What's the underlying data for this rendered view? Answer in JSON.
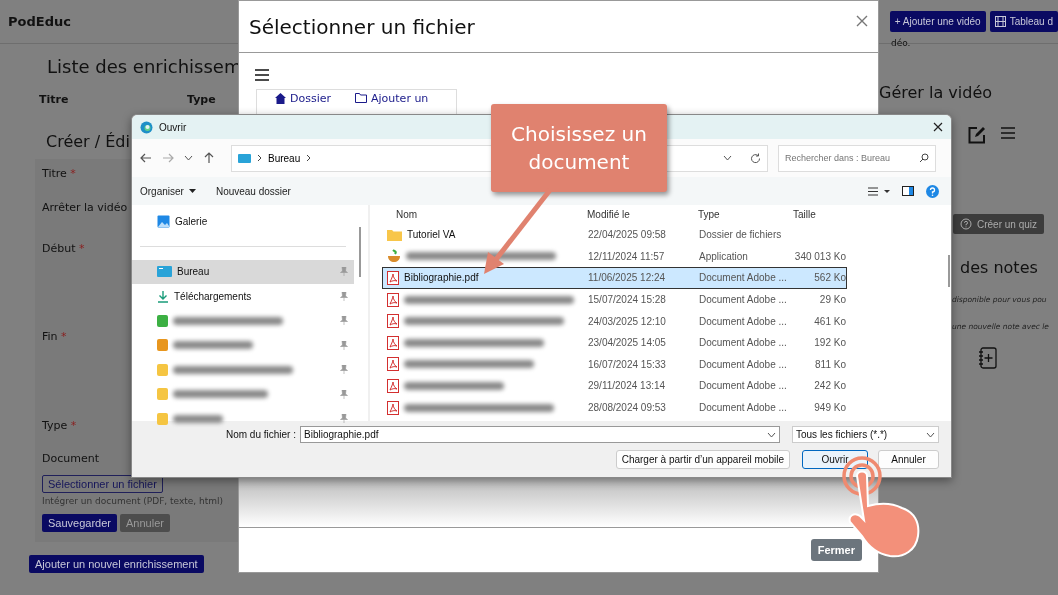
{
  "page": {
    "brand": "PodEduc",
    "header_buttons": [
      {
        "kind": "add",
        "label": "+ Ajouter une vidéo"
      },
      {
        "kind": "dashboard",
        "label": "Tableau d"
      }
    ],
    "left": {
      "title": "Liste des enrichissem",
      "columns": [
        "Titre",
        "Type"
      ],
      "form_title": "Créer / Édi",
      "fields": [
        {
          "label": "Titre",
          "mark": "*"
        },
        {
          "label": "Arrêter la vidéo"
        },
        {
          "label": "Début",
          "mark": "*"
        },
        {
          "label": "Fin",
          "mark": "*"
        },
        {
          "label": "Type",
          "mark": "*"
        },
        {
          "label": "Document"
        }
      ],
      "file_button": "Sélectionner un fichier",
      "hint": "Intégrer un document (PDF, texte, html)",
      "save": "Sauvegarder",
      "cancel": "Annuler",
      "add_button": "Ajouter un nouvel enrichissement"
    },
    "right": {
      "fragment": "déo.",
      "manage_title": "Gérer la vidéo",
      "quiz_button": "Créer un quiz",
      "notes_title": "des notes",
      "notes_lines": [
        "disponible pour vous pou",
        "une nouvelle note avec le"
      ]
    }
  },
  "modal": {
    "title": "Sélectionner un fichier",
    "tabs": [
      {
        "kind": "home",
        "label": "Dossier"
      },
      {
        "kind": "folder",
        "label": "Ajouter un"
      }
    ],
    "close_button": "Fermer"
  },
  "dialog": {
    "title": "Ouvrir",
    "path": [
      "Bureau"
    ],
    "search_placeholder": "Rechercher dans : Bureau",
    "toolbar": [
      "Organiser",
      "Nouveau dossier"
    ],
    "sidebar": [
      {
        "kind": "gallery",
        "label": "Galerie",
        "selected": false
      },
      {
        "kind": "desktop",
        "label": "Bureau",
        "selected": true
      },
      {
        "kind": "download",
        "label": "Téléchargements",
        "selected": false
      },
      {
        "kind": "blurred",
        "color": "#3cb043",
        "selected": false
      },
      {
        "kind": "blurred",
        "color": "#e8961e",
        "selected": false
      },
      {
        "kind": "blurred",
        "color": "#f5c542",
        "selected": false
      },
      {
        "kind": "blurred",
        "color": "#f5c542",
        "selected": false
      },
      {
        "kind": "blurred",
        "color": "#f5c542",
        "selected": false
      }
    ],
    "columns": [
      "Nom",
      "Modifié le",
      "Type",
      "Taille"
    ],
    "rows": [
      {
        "kind": "folder",
        "name": "Tutoriel VA",
        "modified": "22/04/2025 09:58",
        "type": "Dossier de fichiers",
        "selected": false
      },
      {
        "kind": "app",
        "modified": "12/11/2024 11:57",
        "type": "Application",
        "size": "340 013 Ko",
        "selected": false
      },
      {
        "kind": "pdf",
        "name": "Bibliographie.pdf",
        "modified": "11/06/2025 12:24",
        "type": "Document Adobe ...",
        "size": "562 Ko",
        "selected": true
      },
      {
        "kind": "pdf",
        "modified": "15/07/2024 15:28",
        "type": "Document Adobe ...",
        "size": "29 Ko",
        "selected": false
      },
      {
        "kind": "pdf",
        "modified": "24/03/2025 12:10",
        "type": "Document Adobe ...",
        "size": "461 Ko",
        "selected": false
      },
      {
        "kind": "pdf",
        "modified": "23/04/2025 14:05",
        "type": "Document Adobe ...",
        "size": "192 Ko",
        "selected": false
      },
      {
        "kind": "pdf",
        "modified": "16/07/2024 15:33",
        "type": "Document Adobe ...",
        "size": "811 Ko",
        "selected": false
      },
      {
        "kind": "pdf",
        "modified": "29/11/2024 13:14",
        "type": "Document Adobe ...",
        "size": "242 Ko",
        "selected": false
      },
      {
        "kind": "pdf",
        "modified": "28/08/2024 09:53",
        "type": "Document Adobe ...",
        "size": "949 Ko",
        "selected": false
      }
    ],
    "filename_label": "Nom du fichier :",
    "filename": "Bibliographie.pdf",
    "filter": "Tous les fichiers (*.*)",
    "buttons": [
      {
        "label": "Charger à partir d’un appareil mobile",
        "primary": false
      },
      {
        "label": "Ouvrir",
        "primary": true
      },
      {
        "label": "Annuler",
        "primary": false
      }
    ]
  },
  "callout": {
    "text": "Choisissez un document"
  }
}
